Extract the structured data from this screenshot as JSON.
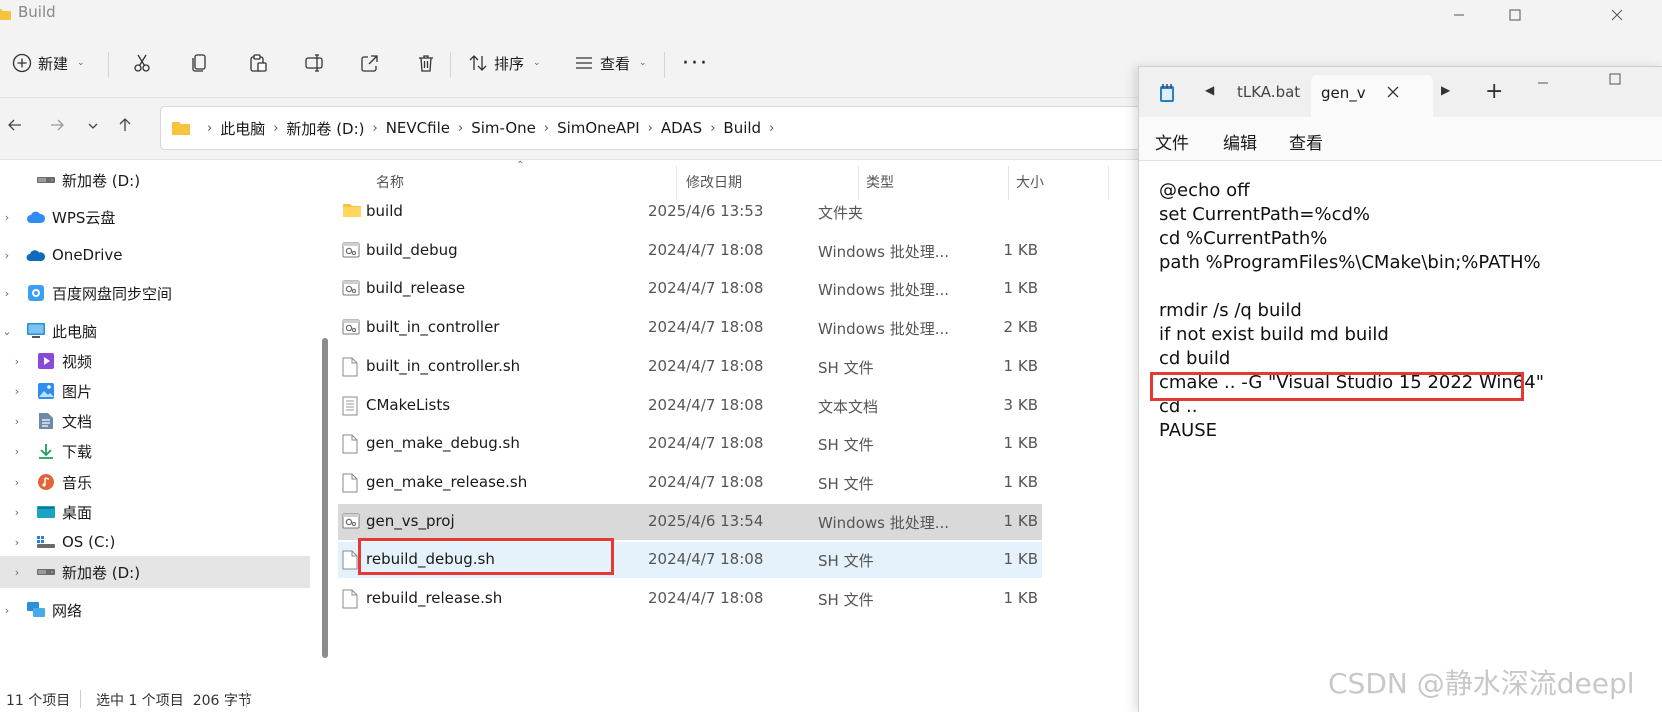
{
  "window": {
    "title": "Build"
  },
  "toolbar": {
    "new_label": "新建",
    "sort_label": "排序",
    "view_label": "查看"
  },
  "nav": {
    "breadcrumb": [
      "此电脑",
      "新加卷 (D:)",
      "NEVCfile",
      "Sim-One",
      "SimOneAPI",
      "ADAS",
      "Build"
    ]
  },
  "sidebar": {
    "items": [
      {
        "label": "新加卷 (D:)",
        "icon": "drive-icon",
        "indent": 1,
        "arrow": ""
      },
      {
        "label": "WPS云盘",
        "icon": "cloud-icon",
        "indent": 0,
        "arrow": "›"
      },
      {
        "label": "OneDrive",
        "icon": "onedrive-icon",
        "indent": 0,
        "arrow": "›"
      },
      {
        "label": "百度网盘同步空间",
        "icon": "baidu-icon",
        "indent": 0,
        "arrow": "›"
      },
      {
        "label": "此电脑",
        "icon": "pc-icon",
        "indent": 0,
        "arrow": "⌄"
      },
      {
        "label": "视频",
        "icon": "video-icon",
        "indent": 1,
        "arrow": "›"
      },
      {
        "label": "图片",
        "icon": "picture-icon",
        "indent": 1,
        "arrow": "›"
      },
      {
        "label": "文档",
        "icon": "document-icon",
        "indent": 1,
        "arrow": "›"
      },
      {
        "label": "下载",
        "icon": "download-icon",
        "indent": 1,
        "arrow": "›"
      },
      {
        "label": "音乐",
        "icon": "music-icon",
        "indent": 1,
        "arrow": "›"
      },
      {
        "label": "桌面",
        "icon": "desktop-icon",
        "indent": 1,
        "arrow": "›"
      },
      {
        "label": "OS (C:)",
        "icon": "windows-drive-icon",
        "indent": 1,
        "arrow": "›"
      },
      {
        "label": "新加卷 (D:)",
        "icon": "drive-icon",
        "indent": 1,
        "arrow": "›"
      },
      {
        "label": "网络",
        "icon": "network-icon",
        "indent": 0,
        "arrow": "›"
      }
    ]
  },
  "columns": {
    "name": "名称",
    "date": "修改日期",
    "type": "类型",
    "size": "大小"
  },
  "files": [
    {
      "name": "build",
      "date": "2025/4/6 13:53",
      "type": "文件夹",
      "size": "",
      "icon": "folder-icon"
    },
    {
      "name": "build_debug",
      "date": "2024/4/7 18:08",
      "type": "Windows 批处理...",
      "size": "1 KB",
      "icon": "batch-file-icon"
    },
    {
      "name": "build_release",
      "date": "2024/4/7 18:08",
      "type": "Windows 批处理...",
      "size": "1 KB",
      "icon": "batch-file-icon"
    },
    {
      "name": "built_in_controller",
      "date": "2024/4/7 18:08",
      "type": "Windows 批处理...",
      "size": "2 KB",
      "icon": "batch-file-icon"
    },
    {
      "name": "built_in_controller.sh",
      "date": "2024/4/7 18:08",
      "type": "SH 文件",
      "size": "1 KB",
      "icon": "file-icon"
    },
    {
      "name": "CMakeLists",
      "date": "2024/4/7 18:08",
      "type": "文本文档",
      "size": "3 KB",
      "icon": "text-file-icon"
    },
    {
      "name": "gen_make_debug.sh",
      "date": "2024/4/7 18:08",
      "type": "SH 文件",
      "size": "1 KB",
      "icon": "file-icon"
    },
    {
      "name": "gen_make_release.sh",
      "date": "2024/4/7 18:08",
      "type": "SH 文件",
      "size": "1 KB",
      "icon": "file-icon"
    },
    {
      "name": "gen_vs_proj",
      "date": "2025/4/6 13:54",
      "type": "Windows 批处理...",
      "size": "1 KB",
      "icon": "batch-file-icon"
    },
    {
      "name": "rebuild_debug.sh",
      "date": "2024/4/7 18:08",
      "type": "SH 文件",
      "size": "1 KB",
      "icon": "file-icon"
    },
    {
      "name": "rebuild_release.sh",
      "date": "2024/4/7 18:08",
      "type": "SH 文件",
      "size": "1 KB",
      "icon": "file-icon"
    }
  ],
  "status": {
    "count": "11 个项目",
    "selection": "选中 1 个项目  206 字节"
  },
  "notepad": {
    "tabs": [
      "tLKA.bat",
      "gen_v"
    ],
    "menu": [
      "文件",
      "编辑",
      "查看"
    ],
    "lines": [
      "@echo off",
      "set CurrentPath=%cd%",
      "cd %CurrentPath%",
      "path %ProgramFiles%\\CMake\\bin;%PATH%",
      "",
      "rmdir /s /q build",
      "if not exist build md build",
      "cd build",
      "cmake .. -G \"Visual Studio 15 2022 Win64\"",
      "cd ..",
      "PAUSE"
    ]
  },
  "watermark": "CSDN @静水深流deepl",
  "colors": {
    "accent": "#0067c0",
    "highlight": "#e53935",
    "selected_row": "#d9d9d9",
    "hover_row": "#e5f1fb"
  }
}
